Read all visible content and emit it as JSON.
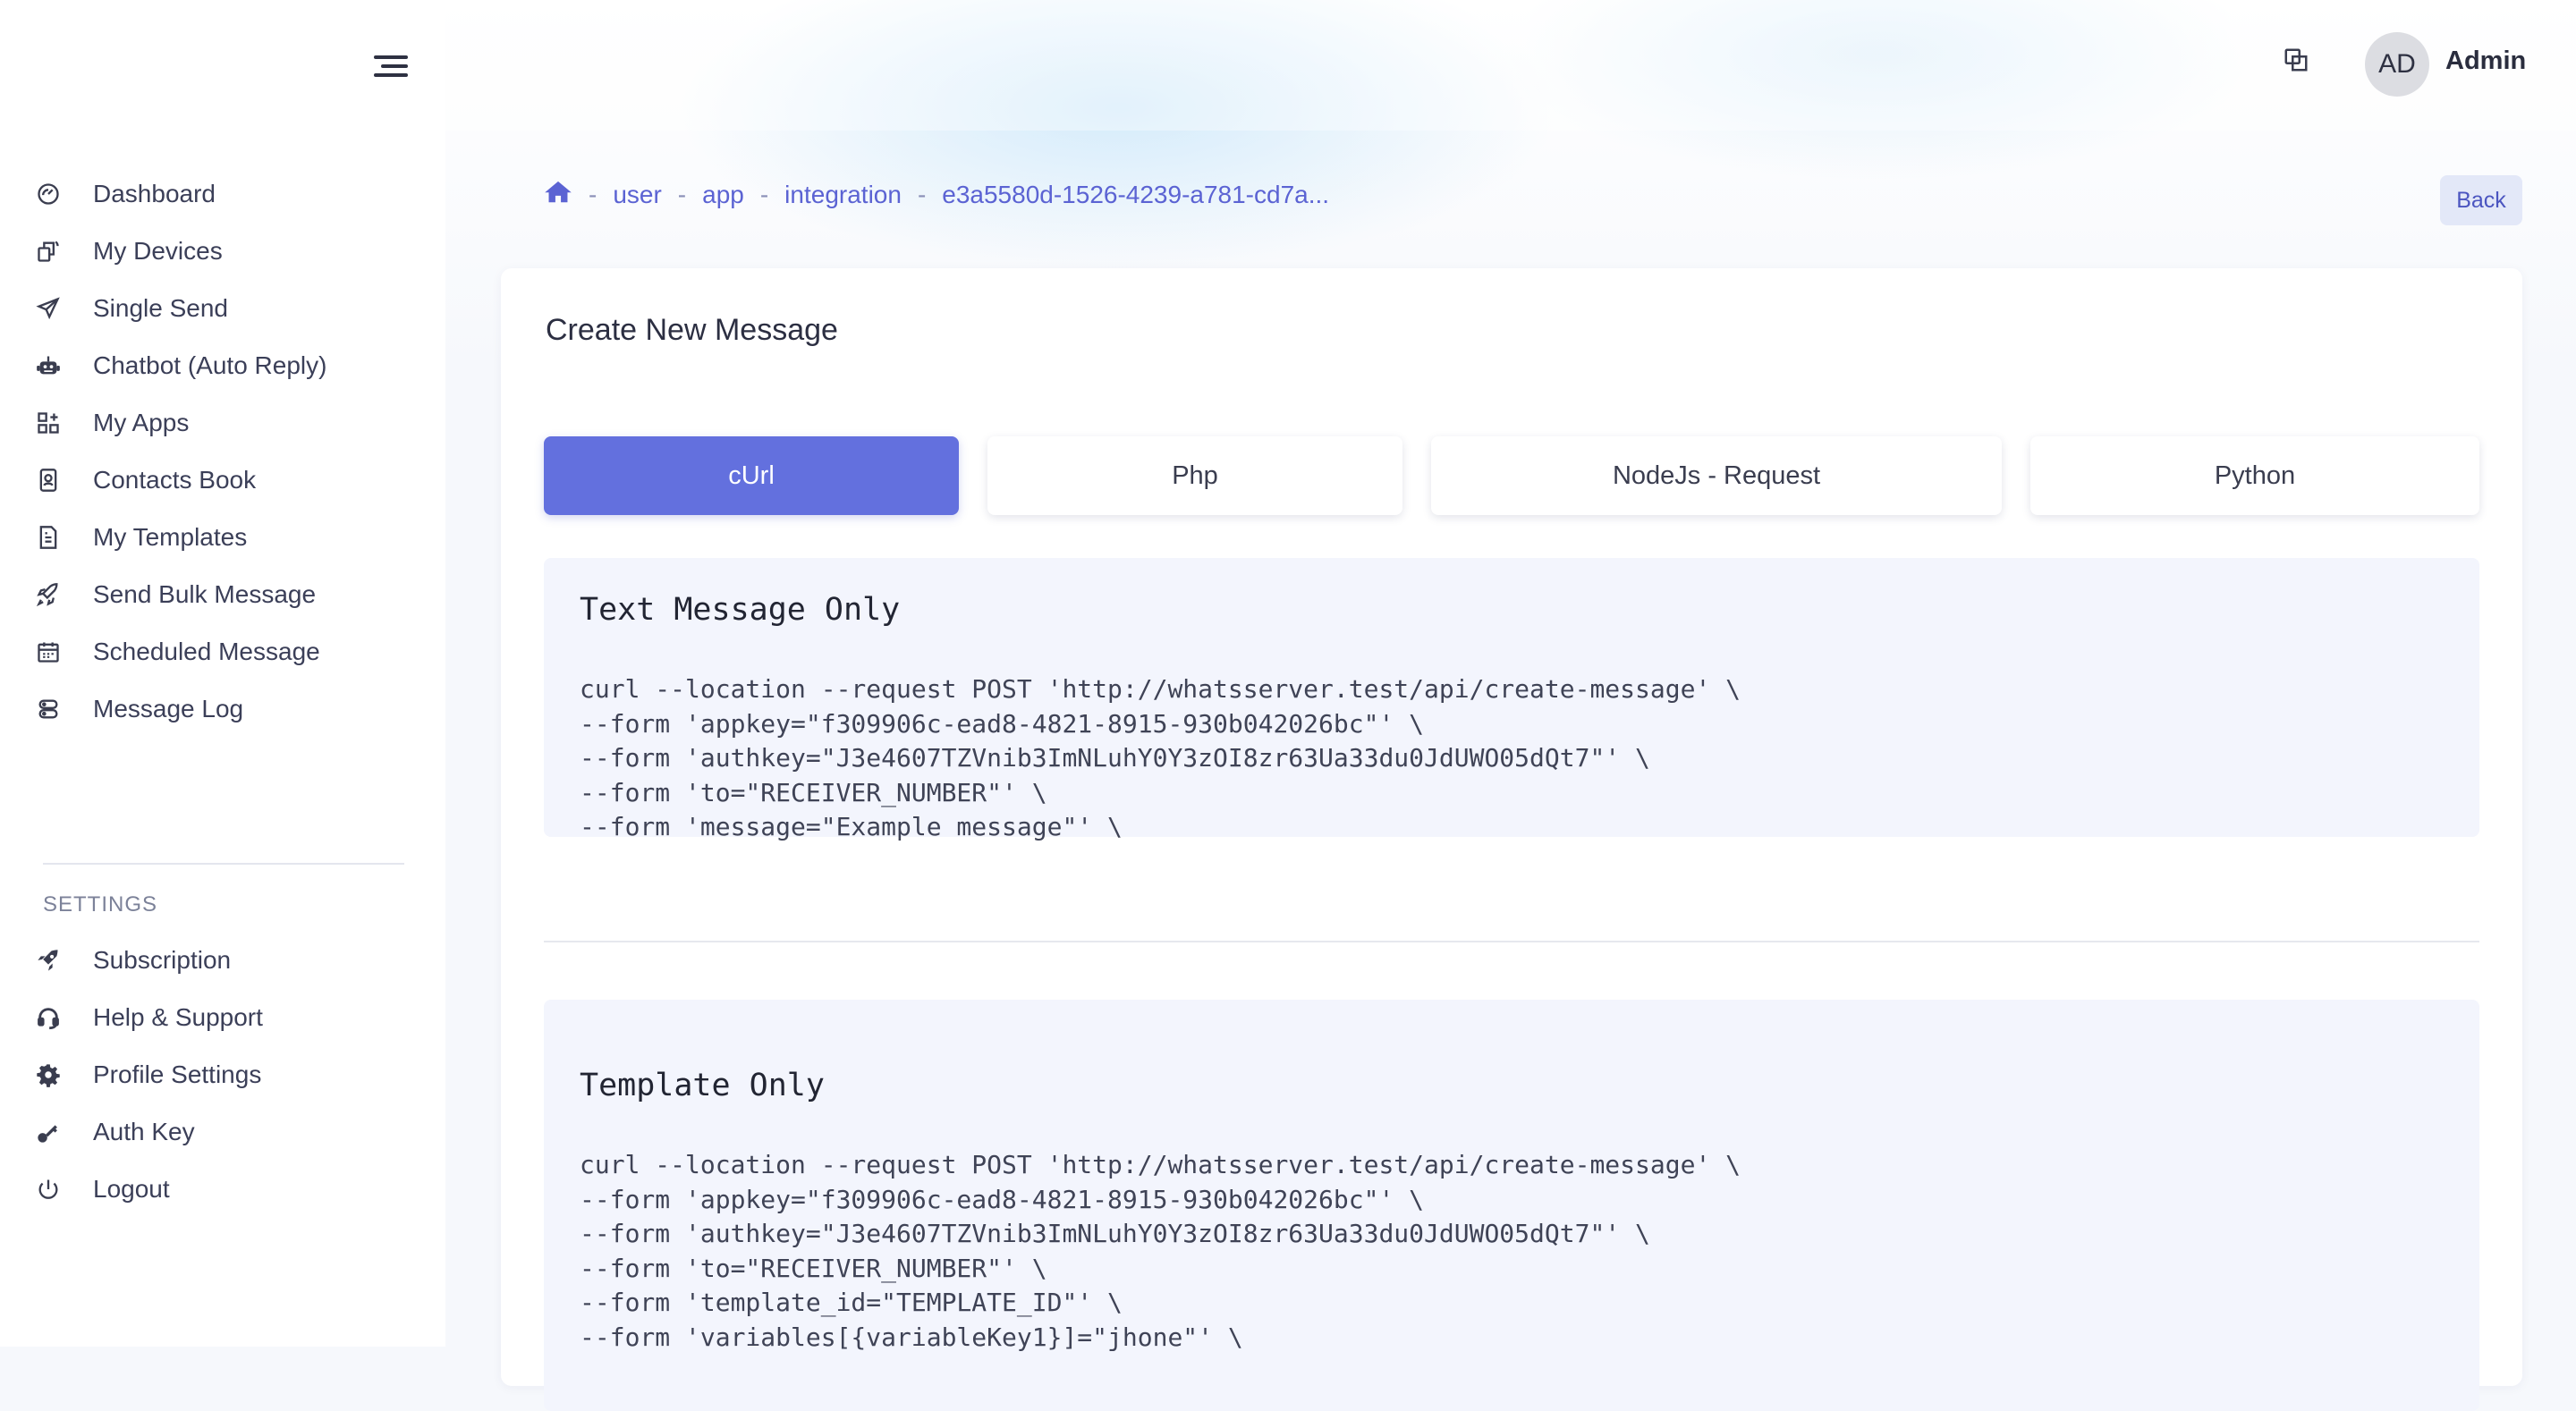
{
  "header": {
    "admin_initials": "AD",
    "admin_name": "Admin"
  },
  "sidebar": {
    "items": [
      {
        "label": "Dashboard",
        "icon": "gauge-icon"
      },
      {
        "label": "My Devices",
        "icon": "devices-icon"
      },
      {
        "label": "Single Send",
        "icon": "paper-plane-icon"
      },
      {
        "label": "Chatbot (Auto Reply)",
        "icon": "robot-icon"
      },
      {
        "label": "My Apps",
        "icon": "apps-grid-icon"
      },
      {
        "label": "Contacts Book",
        "icon": "contacts-book-icon"
      },
      {
        "label": "My Templates",
        "icon": "template-doc-icon"
      },
      {
        "label": "Send Bulk Message",
        "icon": "rocket-icon"
      },
      {
        "label": "Scheduled Message",
        "icon": "calendar-icon"
      },
      {
        "label": "Message Log",
        "icon": "log-icon"
      }
    ],
    "settings_title": "SETTINGS",
    "settings_items": [
      {
        "label": "Subscription",
        "icon": "rocket-badge-icon"
      },
      {
        "label": "Help & Support",
        "icon": "headset-icon"
      },
      {
        "label": "Profile Settings",
        "icon": "gear-icon"
      },
      {
        "label": "Auth Key",
        "icon": "key-icon"
      },
      {
        "label": "Logout",
        "icon": "power-icon"
      }
    ]
  },
  "breadcrumb": {
    "items": [
      "user",
      "app",
      "integration",
      "e3a5580d-1526-4239-a781-cd7a..."
    ],
    "separator": "-"
  },
  "back_label": "Back",
  "card": {
    "title": "Create New Message",
    "tabs": [
      {
        "label": "cUrl",
        "active": true
      },
      {
        "label": "Php",
        "active": false
      },
      {
        "label": "NodeJs - Request",
        "active": false
      },
      {
        "label": "Python",
        "active": false
      }
    ],
    "blocks": [
      {
        "title": "Text Message Only",
        "code": "curl --location --request POST 'http://whatsserver.test/api/create-message' \\\n--form 'appkey=\"f309906c-ead8-4821-8915-930b042026bc\"' \\\n--form 'authkey=\"J3e4607TZVnib3ImNLuhY0Y3zOI8zr63Ua33du0JdUWO05dQt7\"' \\\n--form 'to=\"RECEIVER_NUMBER\"' \\\n--form 'message=\"Example message\"' \\"
      },
      {
        "title": "Template Only",
        "code": "curl --location --request POST 'http://whatsserver.test/api/create-message' \\\n--form 'appkey=\"f309906c-ead8-4821-8915-930b042026bc\"' \\\n--form 'authkey=\"J3e4607TZVnib3ImNLuhY0Y3zOI8zr63Ua33du0JdUWO05dQt7\"' \\\n--form 'to=\"RECEIVER_NUMBER\"' \\\n--form 'template_id=\"TEMPLATE_ID\"' \\\n--form 'variables[{variableKey1}]=\"jhone\"' \\"
      }
    ]
  },
  "colors": {
    "accent": "#6370de",
    "link": "#5b63d3",
    "code_bg": "#f3f5fd"
  }
}
